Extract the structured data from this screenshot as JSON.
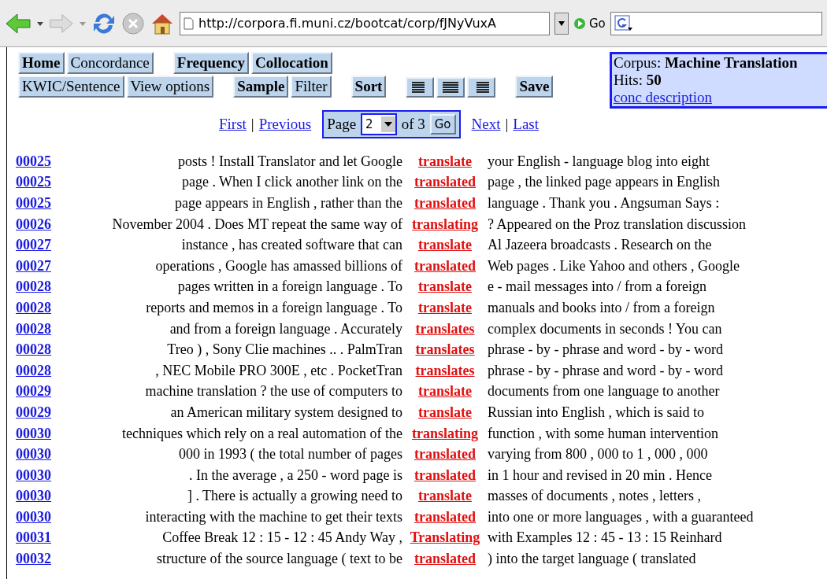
{
  "browser": {
    "url": "http://corpora.fi.muni.cz/bootcat/corp/fJNyVuxA",
    "go": "Go"
  },
  "menu_rows": [
    [
      {
        "label": "Home",
        "bold": true
      },
      {
        "label": "Concordance",
        "bold": false
      },
      {
        "label": "Frequency",
        "bold": true
      },
      {
        "label": "Collocation",
        "bold": true
      }
    ],
    [
      {
        "label": "KWIC/Sentence",
        "bold": false
      },
      {
        "label": "View options",
        "bold": false
      },
      {
        "label": "Sample",
        "bold": true
      },
      {
        "label": "Filter",
        "bold": false
      },
      {
        "label": "Sort",
        "bold": true
      }
    ]
  ],
  "save": "Save",
  "corpus_info": {
    "corpus_label": "Corpus:",
    "corpus": "Machine Translation",
    "hits_label": "Hits:",
    "hits": "50",
    "link": "conc description"
  },
  "pager": {
    "first": "First",
    "separator_1": "|",
    "previous": "Previous",
    "page_label": "Page",
    "page": "2",
    "of": "of 3",
    "go": "Go",
    "next": "Next",
    "separator_2": "|",
    "last": "Last"
  },
  "rows": [
    {
      "ref": "00025",
      "left": "posts ! Install Translator and let Google",
      "kwic": "translate",
      "right": "your English - language blog into eight"
    },
    {
      "ref": "00025",
      "left": "page . When I click another link on the",
      "kwic": "translated",
      "right": "page , the linked page appears in English"
    },
    {
      "ref": "00025",
      "left": "page appears in English , rather than the",
      "kwic": "translated",
      "right": "language . Thank you . Angsuman Says :"
    },
    {
      "ref": "00026",
      "left": "November 2004 . Does MT repeat the same way of",
      "kwic": "translating",
      "right": "? Appeared on the Proz translation discussion"
    },
    {
      "ref": "00027",
      "left": "instance , has created software that can",
      "kwic": "translate",
      "right": "Al Jazeera broadcasts . Research on the"
    },
    {
      "ref": "00027",
      "left": "operations , Google has amassed billions of",
      "kwic": "translated",
      "right": "Web pages . Like Yahoo and others , Google"
    },
    {
      "ref": "00028",
      "left": "pages written in a foreign language . To",
      "kwic": "translate",
      "right": "e - mail messages into / from a foreign"
    },
    {
      "ref": "00028",
      "left": "reports and memos in a foreign language . To",
      "kwic": "translate",
      "right": "manuals and books into / from a foreign"
    },
    {
      "ref": "00028",
      "left": "and from a foreign language . Accurately",
      "kwic": "translates",
      "right": "complex documents in seconds ! You can"
    },
    {
      "ref": "00028",
      "left": "Treo ) , Sony Clie machines .. . PalmTran",
      "kwic": "translates",
      "right": "phrase - by - phrase and word - by - word"
    },
    {
      "ref": "00028",
      "left": ", NEC Mobile PRO 300E , etc . PocketTran",
      "kwic": "translates",
      "right": "phrase - by - phrase and word - by - word"
    },
    {
      "ref": "00029",
      "left": "machine translation ? the use of computers to",
      "kwic": "translate",
      "right": "documents from one language to another"
    },
    {
      "ref": "00029",
      "left": "an American military system designed to",
      "kwic": "translate",
      "right": "Russian into English , which is said to"
    },
    {
      "ref": "00030",
      "left": "techniques which rely on a real automation of the",
      "kwic": "translating",
      "right": "function , with some human intervention"
    },
    {
      "ref": "00030",
      "left": "000 in 1993 ( the total number of pages",
      "kwic": "translated",
      "right": "varying from 800 , 000 to 1 , 000 , 000"
    },
    {
      "ref": "00030",
      "left": ". In the average , a 250 - word page is",
      "kwic": "translated",
      "right": "in 1 hour and revised in 20 min . Hence"
    },
    {
      "ref": "00030",
      "left": "] . There is actually a growing need to",
      "kwic": "translate",
      "right": "masses of documents , notes , letters ,"
    },
    {
      "ref": "00030",
      "left": "interacting with the machine to get their texts",
      "kwic": "translated",
      "right": "into one or more languages , with a guaranteed"
    },
    {
      "ref": "00031",
      "left": "Coffee Break 12 : 15 - 12 : 45 Andy Way ,",
      "kwic": "Translating",
      "right": "with Examples 12 : 45 - 13 : 15 Reinhard"
    },
    {
      "ref": "00032",
      "left": "structure of the source language ( text to be",
      "kwic": "translated",
      "right": ") into the target language ( translated"
    }
  ]
}
